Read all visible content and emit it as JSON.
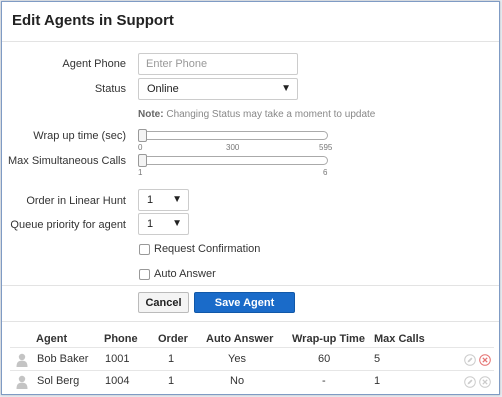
{
  "dialog": {
    "title": "Edit Agents in Support"
  },
  "form": {
    "agent_phone": {
      "label": "Agent Phone",
      "placeholder": "Enter Phone"
    },
    "status": {
      "label": "Status",
      "value": "Online",
      "arrow": "▼"
    },
    "note": {
      "prefix": "Note:",
      "text": " Changing Status may take a moment to update"
    },
    "wrap_up": {
      "label": "Wrap up time (sec)",
      "value": 0,
      "min_label": "0",
      "mid_label": "300",
      "max_label": "595"
    },
    "max_calls": {
      "label": "Max Simultaneous Calls",
      "value": 1,
      "min_label": "1",
      "max_label": "6"
    },
    "order": {
      "label": "Order in Linear Hunt",
      "value": "1",
      "arrow": "▼"
    },
    "queue_priority": {
      "label": "Queue priority for agent",
      "value": "1",
      "arrow": "▼"
    },
    "request_confirmation": {
      "label": "Request Confirmation",
      "checked": false
    },
    "auto_answer": {
      "label": "Auto Answer",
      "checked": false
    }
  },
  "buttons": {
    "cancel": "Cancel",
    "save": "Save Agent"
  },
  "table": {
    "headers": [
      "Agent",
      "Phone",
      "Order",
      "Auto Answer",
      "Wrap-up Time",
      "Max Calls"
    ],
    "rows": [
      {
        "agent": "Bob Baker",
        "phone": "1001",
        "order": "1",
        "auto_answer": "Yes",
        "wrap_up": "60",
        "max_calls": "5"
      },
      {
        "agent": "Sol Berg",
        "phone": "1004",
        "order": "1",
        "auto_answer": "No",
        "wrap_up": "-",
        "max_calls": "1"
      }
    ]
  },
  "icons": {
    "avatar": "user-avatar-icon",
    "edit": "edit-pencil-icon",
    "delete": "delete-x-icon"
  },
  "colors": {
    "primary": "#1a6bc9",
    "border": "#7f9bc4",
    "delete": "#e57373",
    "muted": "#cccccc"
  }
}
